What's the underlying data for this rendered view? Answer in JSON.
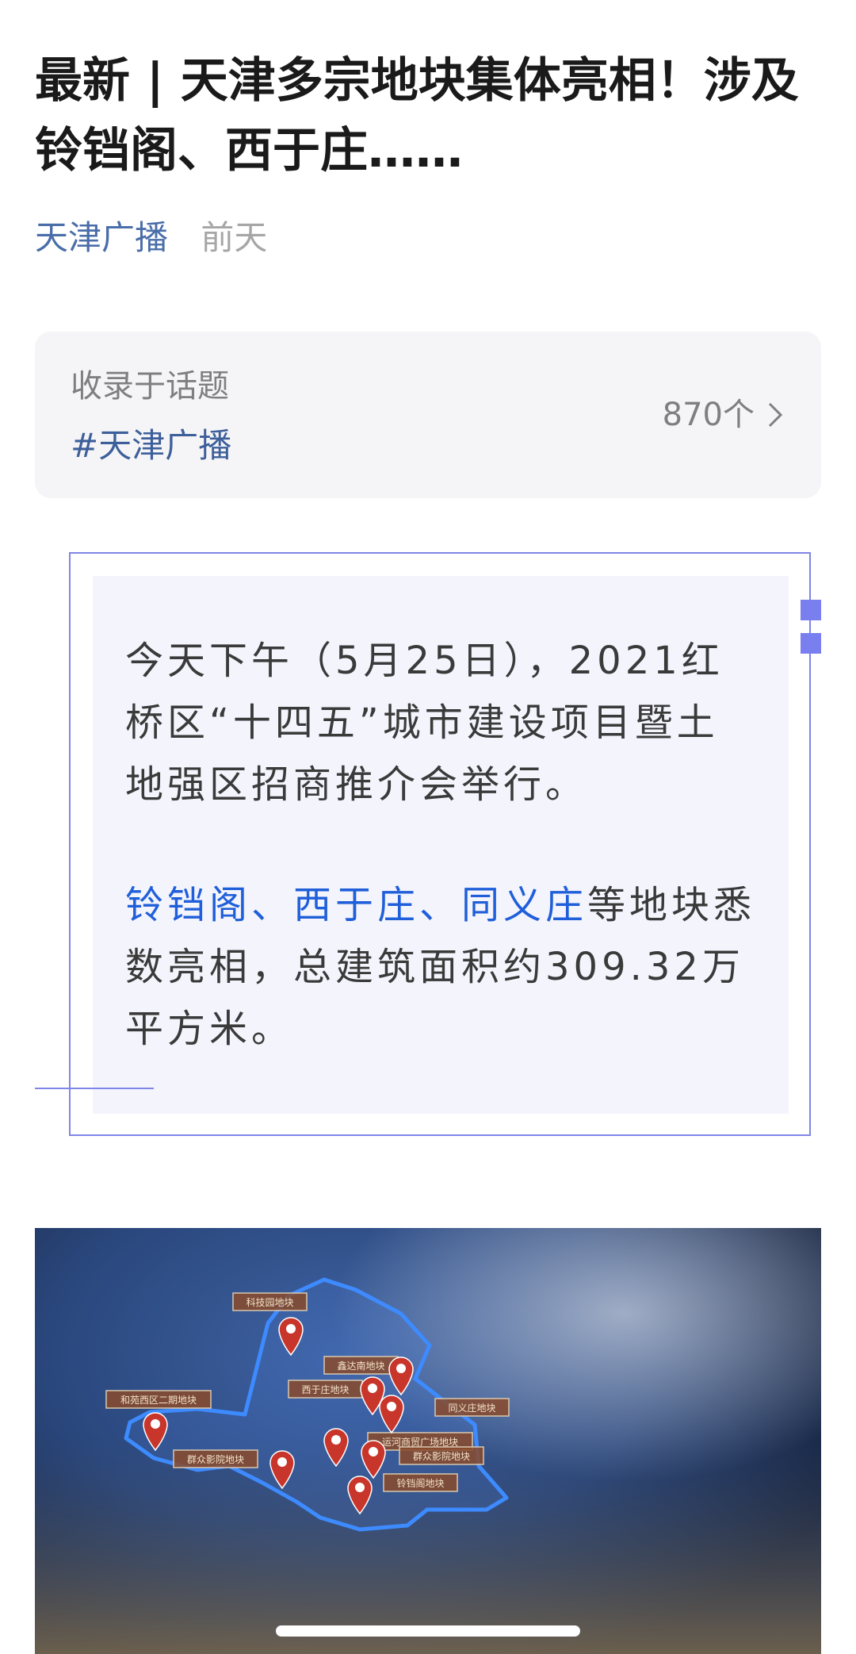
{
  "article": {
    "title": "最新 | 天津多宗地块集体亮相！涉及铃铛阁、西于庄……",
    "author": "天津广播",
    "time": "前天"
  },
  "topic": {
    "label": "收录于话题",
    "tag": "#天津广播",
    "count": "870个",
    "chevron_icon": "chevron-right-icon"
  },
  "body": {
    "p1": "今天下午（5月25日），2021红桥区“十四五”城市建设项目暨土地强区招商推介会举行。",
    "p2_highlight": "铃铛阁、西于庄、同义庄",
    "p2_rest": "等地块悉数亮相，总建筑面积约309.32万平方米。"
  },
  "map": {
    "labels": [
      "科技园地块",
      "鑫达南地块",
      "西于庄地块",
      "同义庄地块",
      "和苑西区二期地块",
      "群众影院地块",
      "运河商贸广场地块",
      "群众影院地块",
      "铃铛阁地块"
    ]
  },
  "colors": {
    "accent": "#1f5fd9",
    "author": "#4a6ea9",
    "frame": "#7f86e8",
    "marker": "#c8352b",
    "boundary": "#3d8bff"
  }
}
